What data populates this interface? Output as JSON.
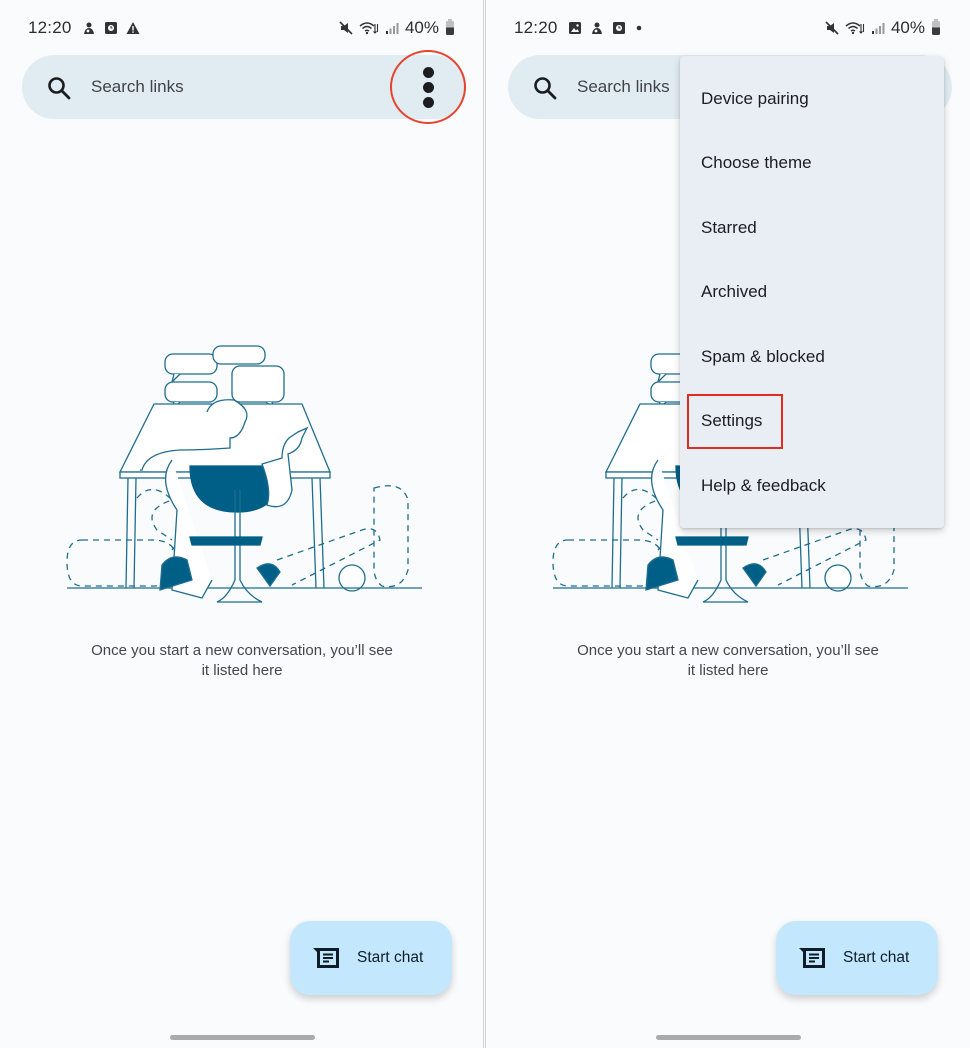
{
  "screens": [
    {
      "status_bar": {
        "time": "12:20",
        "left_icons": [
          "mascot-notification-icon",
          "app-notification-icon",
          "warning-icon"
        ],
        "right_icons": [
          "mute-icon",
          "wifi-icon",
          "signal-icon"
        ],
        "battery_percent": "40%"
      },
      "search": {
        "placeholder": "Search links",
        "more_options": "more-options"
      },
      "empty_state": {
        "line1": "Once you start a new conversation, you’ll see",
        "line2": "it listed here"
      },
      "fab": {
        "label": "Start chat"
      },
      "annotation": "red circle highlighting more options button"
    },
    {
      "status_bar": {
        "time": "12:20",
        "left_icons": [
          "image-notification-icon",
          "mascot-notification-icon",
          "app-notification-icon",
          "dot-icon"
        ],
        "right_icons": [
          "mute-icon",
          "wifi-icon",
          "signal-icon"
        ],
        "battery_percent": "40%"
      },
      "search": {
        "placeholder": "Search links"
      },
      "menu": {
        "items": [
          {
            "label": "Device pairing"
          },
          {
            "label": "Choose theme"
          },
          {
            "label": "Starred"
          },
          {
            "label": "Archived"
          },
          {
            "label": "Spam & blocked"
          },
          {
            "label": "Settings",
            "highlighted": true
          },
          {
            "label": "Help & feedback"
          }
        ]
      },
      "empty_state": {
        "line1": "Once you start a new conversation, you’ll see",
        "line2": "it listed here"
      },
      "fab": {
        "label": "Start chat"
      },
      "annotation": "red rectangle highlighting Settings"
    }
  ],
  "colors": {
    "accent": "#005f86",
    "search_bg": "#e1ecf2",
    "fab_bg": "#c3e8fd",
    "menu_bg": "#e8eef4",
    "highlight": "#e32b20"
  }
}
